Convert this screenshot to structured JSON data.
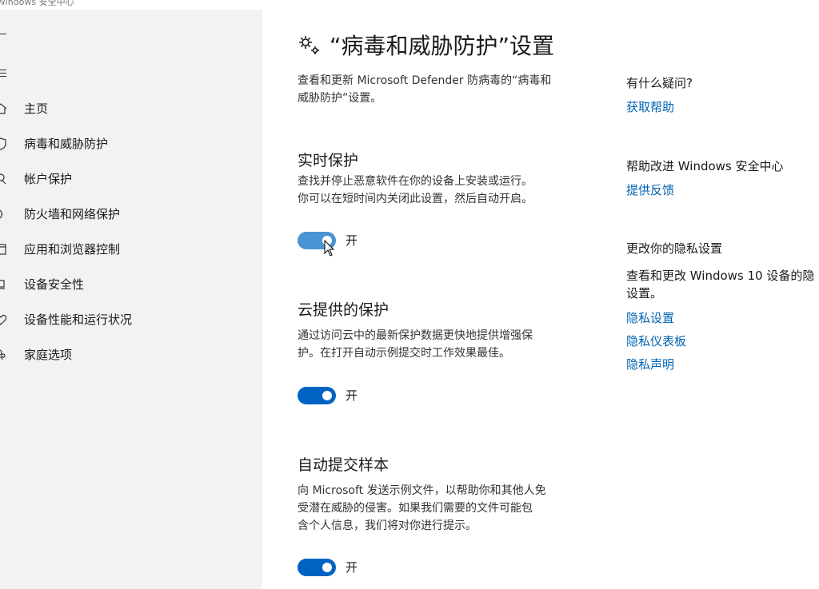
{
  "window": {
    "title": "Windows 安全中心"
  },
  "sidebar": {
    "items": [
      {
        "label": "主页",
        "icon": "home-icon"
      },
      {
        "label": "病毒和威胁防护",
        "icon": "shield-icon"
      },
      {
        "label": "帐户保护",
        "icon": "person-icon"
      },
      {
        "label": "防火墙和网络保护",
        "icon": "wifi-icon"
      },
      {
        "label": "应用和浏览器控制",
        "icon": "app-window-icon"
      },
      {
        "label": "设备安全性",
        "icon": "device-icon"
      },
      {
        "label": "设备性能和运行状况",
        "icon": "heart-icon"
      },
      {
        "label": "家庭选项",
        "icon": "family-icon"
      }
    ]
  },
  "main": {
    "title": "“病毒和威胁防护”设置",
    "description_lines": [
      "查看和更新 Microsoft Defender 防病毒的“病毒和",
      "威胁防护”设置。"
    ],
    "sections": [
      {
        "title": "实时保护",
        "lines": [
          "查找并停止恶意软件在你的设备上安装或运行。",
          "你可以在短时间内关闭此设置，然后自动开启。"
        ],
        "toggle_on": true,
        "toggle_label": "开"
      },
      {
        "title": "云提供的保护",
        "lines": [
          "通过访问云中的最新保护数据更快地提供增强保",
          "护。在打开自动示例提交时工作效果最佳。"
        ],
        "toggle_on": true,
        "toggle_label": "开"
      },
      {
        "title": "自动提交样本",
        "lines": [
          "向 Microsoft 发送示例文件，以帮助你和其他人免",
          "受潜在威胁的侵害。如果我们需要的文件可能包",
          "含个人信息，我们将对你进行提示。"
        ],
        "toggle_on": true,
        "toggle_label": "开"
      }
    ]
  },
  "side": {
    "question_heading": "有什么疑问?",
    "help_link": "获取帮助",
    "improve_heading": "帮助改进 Windows 安全中心",
    "feedback_link": "提供反馈",
    "privacy_heading": "更改你的隐私设置",
    "privacy_text_lines": [
      "查看和更改 Windows 10 设备的隐",
      "设置。"
    ],
    "privacy_links": [
      "隐私设置",
      "隐私仪表板",
      "隐私声明"
    ]
  },
  "colors": {
    "accent": "#0063c4",
    "link": "#0063b1",
    "sidebar_bg": "#f2f2f2"
  }
}
